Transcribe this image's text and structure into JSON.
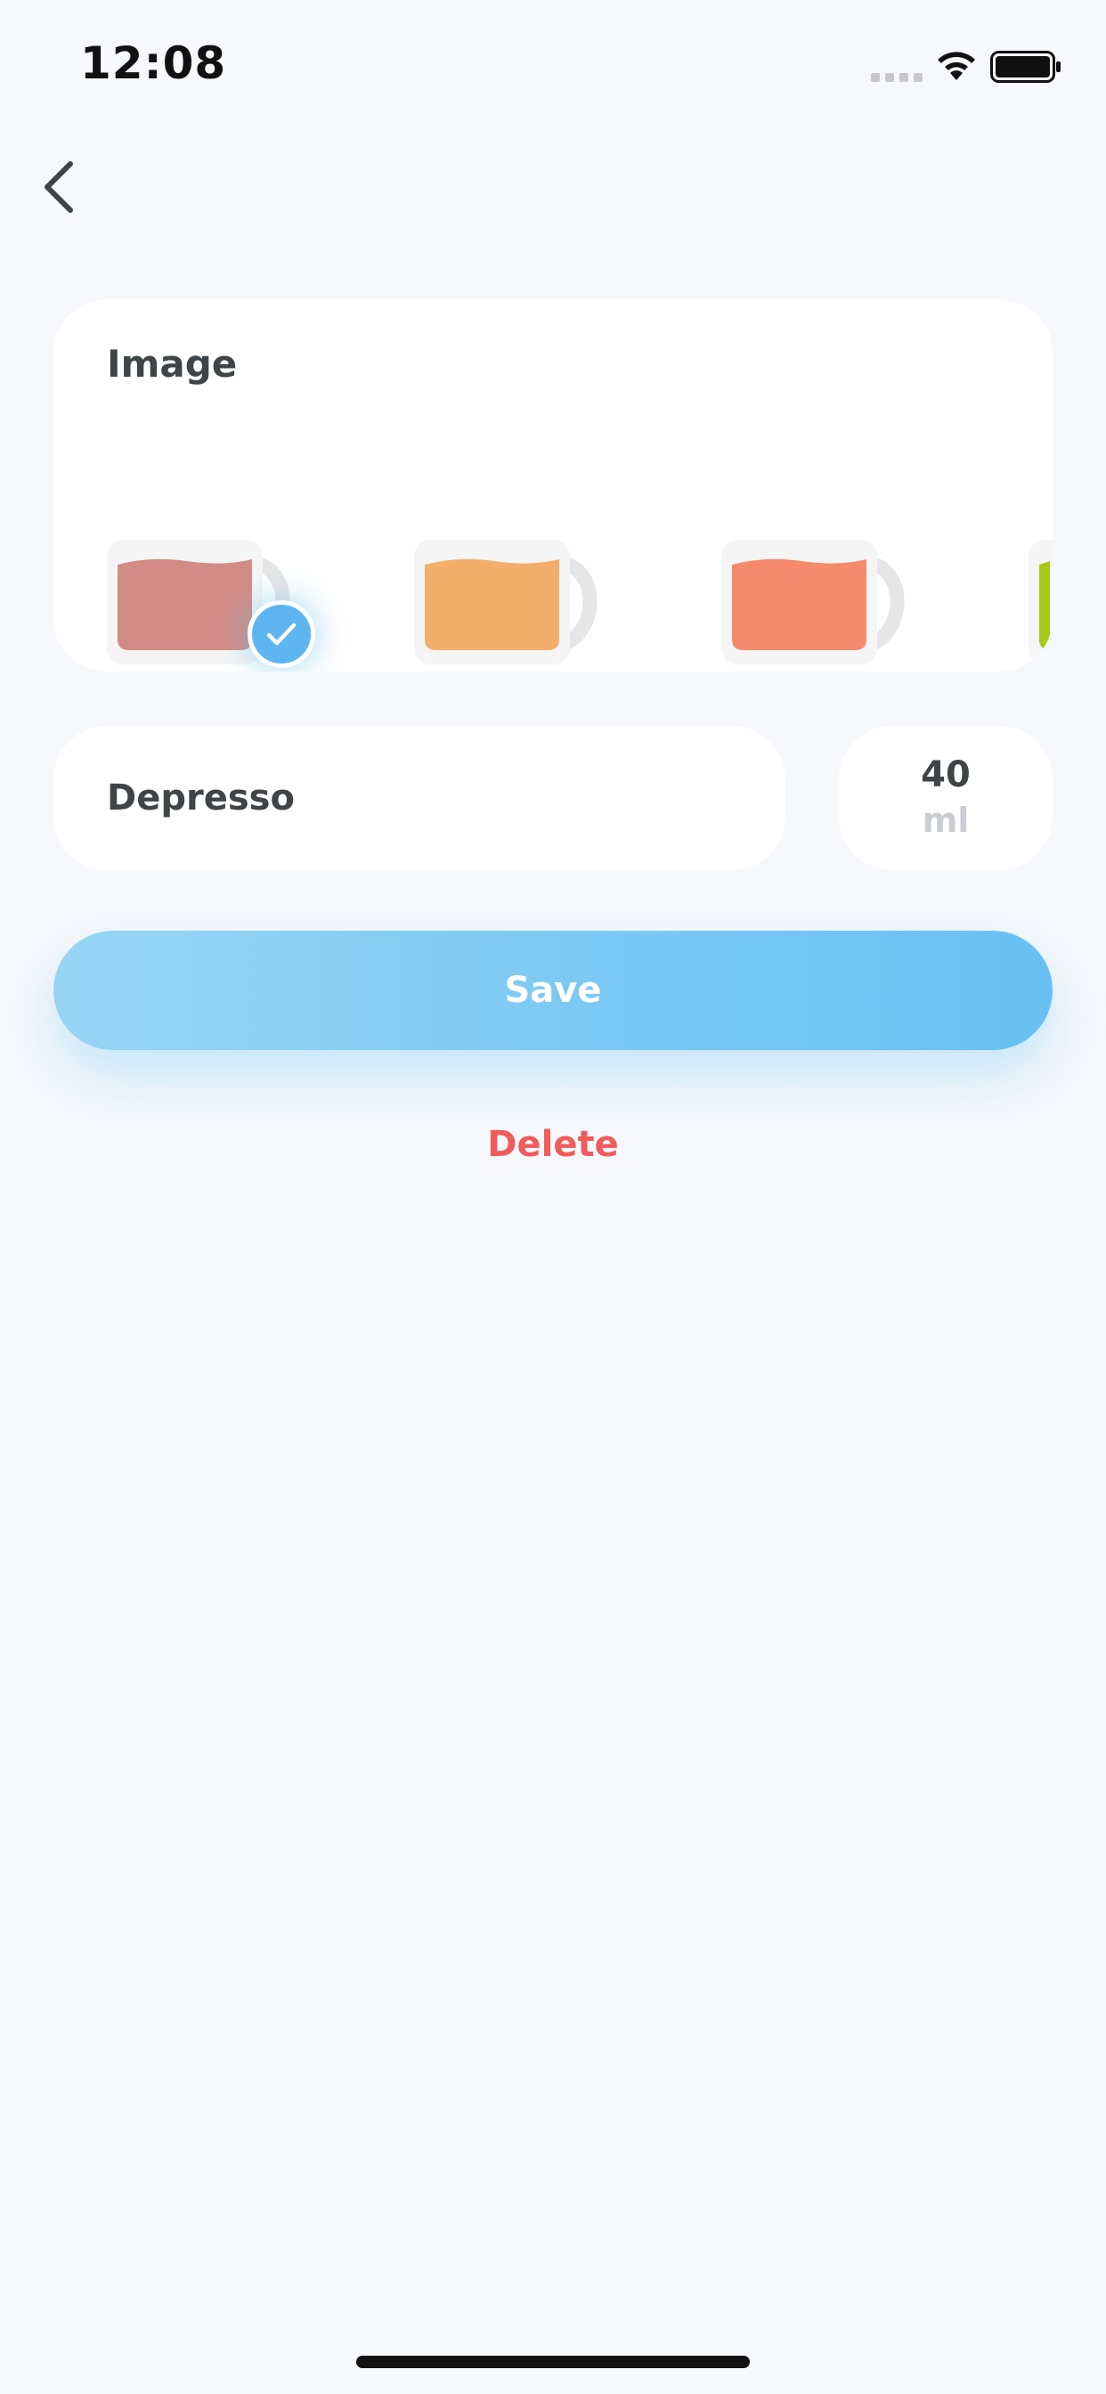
{
  "status_bar": {
    "time": "12:08",
    "icons": [
      "signal-icon",
      "wifi-icon",
      "battery-icon"
    ]
  },
  "navigation": {
    "back_icon": "chevron-left-icon"
  },
  "image_picker": {
    "title": "Image",
    "options": [
      {
        "name": "cup-mauve",
        "color": "#d38c85",
        "selected": true
      },
      {
        "name": "cup-orange",
        "color": "#f4ae6b",
        "selected": false
      },
      {
        "name": "cup-coral",
        "color": "#f58a6c",
        "selected": false
      },
      {
        "name": "cup-green",
        "color": "#a8c81a",
        "selected": false
      }
    ],
    "selected_badge_icon": "check-icon"
  },
  "drink": {
    "name": "Depresso",
    "volume": "40",
    "unit": "ml"
  },
  "actions": {
    "save_label": "Save",
    "delete_label": "Delete"
  },
  "colors": {
    "background": "#f6f8fc",
    "accent": "#6fc3f3",
    "danger": "#f25a5a",
    "text_primary": "#3f4447",
    "text_muted": "#c9ccd0"
  }
}
